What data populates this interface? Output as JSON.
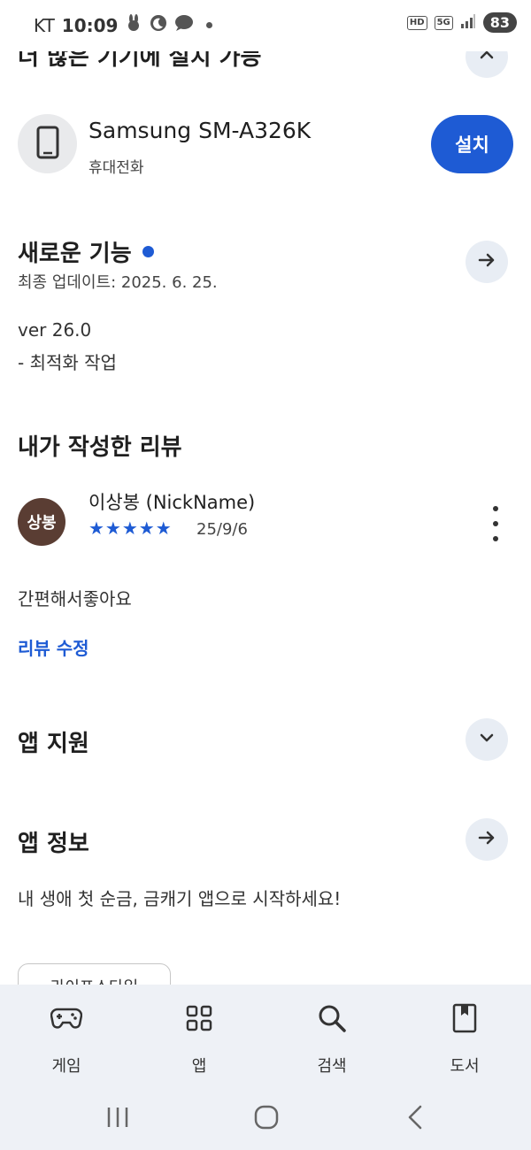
{
  "status_bar": {
    "carrier": "KT",
    "time": "10:09",
    "hd_label": "HD",
    "network_label": "5G",
    "battery": "83"
  },
  "devices_section": {
    "title": "더 많은 기기에 설치 가능",
    "device_name": "Samsung SM-A326K",
    "device_type": "휴대전화",
    "install_label": "설치"
  },
  "whats_new": {
    "title": "새로운 기능",
    "updated": "최종 업데이트: 2025. 6. 25.",
    "version": "ver 26.0",
    "note": "- 최적화 작업"
  },
  "my_review": {
    "title": "내가 작성한 리뷰",
    "avatar_text": "상봉",
    "reviewer": "이상봉 (NickName)",
    "stars": "★★★★★",
    "rating": 5,
    "date": "25/9/6",
    "text": "간편해서좋아요",
    "edit_label": "리뷰 수정"
  },
  "app_support": {
    "title": "앱 지원"
  },
  "app_info": {
    "title": "앱 정보",
    "description": "내 생애 첫 순금, 금캐기 앱으로 시작하세요!",
    "chip_label": "라이프스타일"
  },
  "bottom_nav": {
    "items": [
      {
        "label": "게임",
        "icon": "gamepad-icon"
      },
      {
        "label": "앱",
        "icon": "apps-grid-icon"
      },
      {
        "label": "검색",
        "icon": "search-icon"
      },
      {
        "label": "도서",
        "icon": "book-icon"
      }
    ]
  },
  "system_nav": {
    "icons": [
      "recent-apps-icon",
      "home-icon",
      "back-icon"
    ]
  },
  "colors": {
    "accent": "#1e5bd4",
    "nav_background": "#eef1f6",
    "avatar_background": "#5a3d33"
  }
}
